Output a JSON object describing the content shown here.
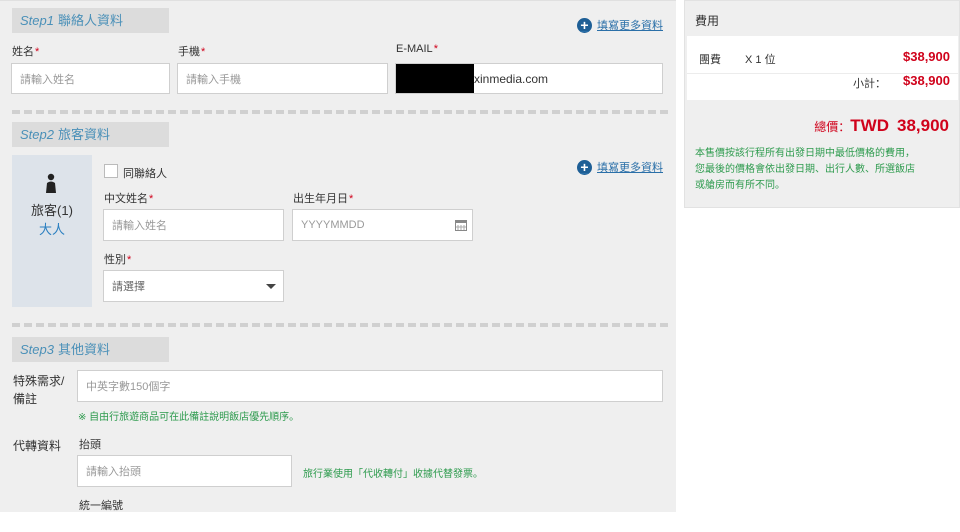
{
  "step1": {
    "step_no": "Step1",
    "title": "聯絡人資料",
    "more_link": "填寫更多資料",
    "name_label": "姓名",
    "name_placeholder": "請輸入姓名",
    "phone_label": "手機",
    "phone_placeholder": "請輸入手機",
    "email_label": "E-MAIL",
    "email_value": "xinmedia.com"
  },
  "step2": {
    "step_no": "Step2",
    "title": "旅客資料",
    "traveler_title": "旅客(1)",
    "traveler_type": "大人",
    "same_contact_label": "同聯絡人",
    "more_link": "填寫更多資料",
    "cname_label": "中文姓名",
    "cname_placeholder": "請輸入姓名",
    "birth_label": "出生年月日",
    "birth_placeholder": "YYYYMMDD",
    "gender_label": "性別",
    "gender_selected": "請選擇"
  },
  "step3": {
    "step_no": "Step3",
    "title": "其他資料",
    "special_label_1": "特殊需求/",
    "special_label_2": "備註",
    "special_placeholder": "中英字數150個字",
    "special_note": "※ 自由行旅遊商品可在此備註說明飯店優先順序。",
    "proxy_label": "代轉資料",
    "header_label": "抬頭",
    "header_placeholder": "請輸入抬頭",
    "agency_note": "旅行業使用「代收轉付」收據代替發票。",
    "taxid_label": "統一編號"
  },
  "summary": {
    "title": "費用",
    "item_name": "團費",
    "item_qty": "X 1 位",
    "item_price": "$38,900",
    "subtotal_label": "小計：",
    "subtotal_value": "$38,900",
    "total_label": "總價：",
    "total_currency": "TWD",
    "total_value": "38,900",
    "note_line1": "本售價按該行程所有出發日期中最低價格的費用，",
    "note_line2": "您最後的價格會依出發日期、出行人數、所選飯店",
    "note_line3": "或艙房而有所不同。"
  },
  "colors": {
    "accent": "#4a90b8",
    "price": "#d0021b",
    "note": "#2e9b4e",
    "link": "#2a6fa8"
  },
  "icons": [
    "plus-circle-icon",
    "person-icon",
    "calendar-icon",
    "caret-down-icon",
    "checkbox-icon"
  ]
}
